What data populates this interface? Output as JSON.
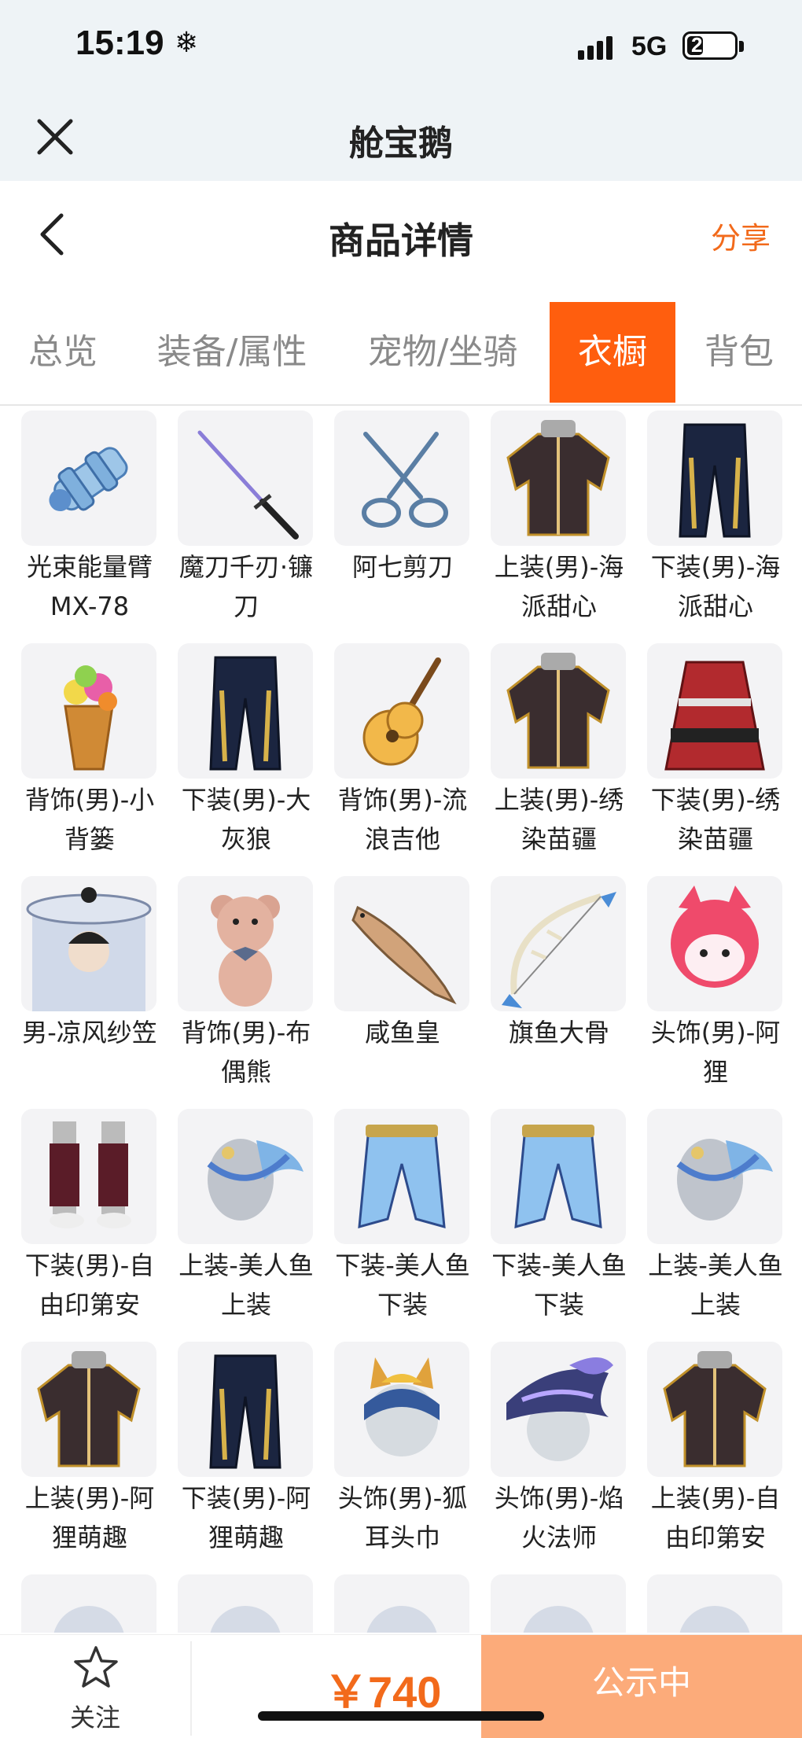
{
  "status": {
    "time": "15:19",
    "network": "5G",
    "battery": "21",
    "battery_level": 0.21
  },
  "app": {
    "title": "舱宝鹅"
  },
  "nav": {
    "title": "商品详情",
    "share": "分享"
  },
  "tabs": [
    {
      "label": "总览",
      "active": false
    },
    {
      "label": "装备/属性",
      "active": false
    },
    {
      "label": "宠物/坐骑",
      "active": false
    },
    {
      "label": "衣橱",
      "active": true
    },
    {
      "label": "背包",
      "active": false
    }
  ],
  "items": [
    {
      "name": "光束能量臂MX-78",
      "icon": "robot-arm-icon"
    },
    {
      "name": "魔刀千刃·镰刀",
      "icon": "katana-icon"
    },
    {
      "name": "阿七剪刀",
      "icon": "scissors-icon"
    },
    {
      "name": "上装(男)-海派甜心",
      "icon": "jacket-icon"
    },
    {
      "name": "下装(男)-海派甜心",
      "icon": "pants-icon"
    },
    {
      "name": "背饰(男)-小背篓",
      "icon": "flower-basket-icon"
    },
    {
      "name": "下装(男)-大灰狼",
      "icon": "pants-icon"
    },
    {
      "name": "背饰(男)-流浪吉他",
      "icon": "guitar-icon"
    },
    {
      "name": "上装(男)-绣染苗疆",
      "icon": "jacket-icon"
    },
    {
      "name": "下装(男)-绣染苗疆",
      "icon": "skirt-icon"
    },
    {
      "name": "男-凉风纱笠",
      "icon": "veil-hat-icon"
    },
    {
      "name": "背饰(男)-布偶熊",
      "icon": "teddy-bear-icon"
    },
    {
      "name": "咸鱼皇",
      "icon": "fish-icon"
    },
    {
      "name": "旗鱼大骨",
      "icon": "fish-bone-bow-icon"
    },
    {
      "name": "头饰(男)-阿狸",
      "icon": "fox-head-icon"
    },
    {
      "name": "下装(男)-自由印第安",
      "icon": "boots-icon"
    },
    {
      "name": "上装-美人鱼上装",
      "icon": "mermaid-top-icon"
    },
    {
      "name": "下装-美人鱼下装",
      "icon": "mermaid-bottom-icon"
    },
    {
      "name": "下装-美人鱼下装",
      "icon": "mermaid-bottom-icon"
    },
    {
      "name": "上装-美人鱼上装",
      "icon": "mermaid-top-icon"
    },
    {
      "name": "上装(男)-阿狸萌趣",
      "icon": "jacket-icon"
    },
    {
      "name": "下装(男)-阿狸萌趣",
      "icon": "pants-icon"
    },
    {
      "name": "头饰(男)-狐耳头巾",
      "icon": "headband-icon"
    },
    {
      "name": "头饰(男)-焰火法师",
      "icon": "wizard-hat-icon"
    },
    {
      "name": "上装(男)-自由印第安",
      "icon": "jacket-icon"
    },
    {
      "name": "",
      "icon": "partial-item-icon"
    },
    {
      "name": "",
      "icon": "partial-item-icon"
    },
    {
      "name": "",
      "icon": "partial-item-icon"
    },
    {
      "name": "",
      "icon": "partial-item-icon"
    },
    {
      "name": "",
      "icon": "partial-item-icon"
    }
  ],
  "bottom": {
    "follow": "关注",
    "price": "￥740",
    "action": "公示中"
  },
  "colors": {
    "accent": "#ff5e0e",
    "price": "#f26a1b",
    "action_bg": "#fcab7a",
    "header_bg": "#eef3f6"
  }
}
